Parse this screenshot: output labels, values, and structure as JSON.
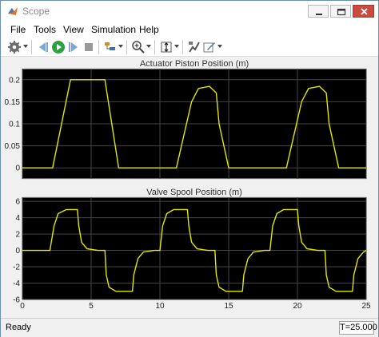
{
  "window": {
    "title": "Scope"
  },
  "menu": [
    "File",
    "Tools",
    "View",
    "Simulation",
    "Help"
  ],
  "toolbar_icons": [
    "settings-icon",
    "settings-dropdown-icon",
    "step-back-icon",
    "run-icon",
    "step-forward-icon",
    "stop-icon",
    "highlight-icon",
    "highlight-dropdown-icon",
    "zoom-in-icon",
    "zoom-dropdown-icon",
    "autoscale-icon",
    "autoscale-dropdown-icon",
    "signal-icon",
    "write-icon",
    "write-dropdown-icon"
  ],
  "status": {
    "left": "Ready",
    "right": "T=25.000"
  },
  "colors": {
    "background": "#000000",
    "line": "#e6e600",
    "grid": "#444444",
    "tick_text": "#ffffff",
    "axes_frame": "#cccccc"
  },
  "chart_data": [
    {
      "type": "line",
      "title": "Actuator Piston Position (m)",
      "xlabel": "",
      "ylabel": "",
      "xlim": [
        0,
        25
      ],
      "ylim": [
        -0.025,
        0.225
      ],
      "xticks": [
        0,
        5,
        10,
        15,
        20,
        25
      ],
      "yticks": [
        0,
        0.05,
        0.1,
        0.15,
        0.2
      ],
      "ytick_labels": [
        "0",
        "0.05",
        "0.1",
        "0.15",
        "0.2"
      ],
      "grid": true,
      "show_xtick_labels": false,
      "series": [
        {
          "x": [
            0,
            2.2,
            3.5,
            6.0,
            6.5,
            7.0,
            11.0,
            11.2,
            12.3,
            12.8,
            13.6,
            14.1,
            14.3,
            15.0,
            19.0,
            19.2,
            20.3,
            20.8,
            21.6,
            22.1,
            22.3,
            23.0,
            25.0
          ],
          "y": [
            0,
            0,
            0.2,
            0.2,
            0.1,
            0,
            0,
            0,
            0.15,
            0.18,
            0.185,
            0.17,
            0.1,
            0,
            0,
            0,
            0.15,
            0.18,
            0.185,
            0.17,
            0.1,
            0,
            0
          ]
        }
      ]
    },
    {
      "type": "line",
      "title": "Valve Spool Position (m)",
      "xlabel": "",
      "ylabel": "",
      "xlim": [
        0,
        25
      ],
      "ylim": [
        -6,
        6.5
      ],
      "xticks": [
        0,
        5,
        10,
        15,
        20,
        25
      ],
      "xtick_labels": [
        "0",
        "5",
        "10",
        "15",
        "20",
        "25"
      ],
      "yticks": [
        -6,
        -4,
        -2,
        0,
        2,
        4,
        6
      ],
      "ytick_labels": [
        "-6",
        "-4",
        "-2",
        "0",
        "2",
        "4",
        "6"
      ],
      "grid": true,
      "show_xtick_labels": true,
      "series": [
        {
          "x": [
            0,
            2.0,
            2.3,
            2.6,
            3.2,
            4.0,
            4.1,
            4.3,
            4.7,
            5.5,
            6.0,
            6.1,
            6.3,
            6.8,
            7.2,
            8.0,
            8.1,
            8.4,
            8.8,
            9.6,
            10.0,
            10.2,
            10.5,
            11.0,
            12.0,
            12.1,
            12.3,
            12.7,
            13.5,
            14.0,
            14.1,
            14.3,
            14.8,
            15.2,
            16.0,
            16.1,
            16.4,
            16.8,
            17.6,
            18.0,
            18.2,
            18.5,
            19.0,
            20.0,
            20.1,
            20.3,
            20.7,
            21.5,
            22.0,
            22.1,
            22.3,
            22.8,
            23.2,
            24.0,
            24.1,
            24.4,
            24.8,
            25.0
          ],
          "y": [
            0,
            0,
            3.0,
            4.5,
            5.0,
            5.0,
            3.0,
            1.0,
            0.2,
            0,
            0,
            -3.0,
            -4.5,
            -5.0,
            -5.0,
            -5.0,
            -3.0,
            -1.0,
            -0.2,
            0,
            0,
            3.0,
            4.5,
            5.0,
            5.0,
            3.0,
            1.0,
            0.2,
            0,
            0,
            -3.0,
            -4.5,
            -5.0,
            -5.0,
            -5.0,
            -3.0,
            -1.0,
            -0.2,
            0,
            0,
            3.0,
            4.5,
            5.0,
            5.0,
            3.0,
            1.0,
            0.2,
            0,
            0,
            -3.0,
            -4.5,
            -5.0,
            -5.0,
            -5.0,
            -3.0,
            -1.0,
            -0.2,
            0
          ]
        }
      ]
    }
  ]
}
